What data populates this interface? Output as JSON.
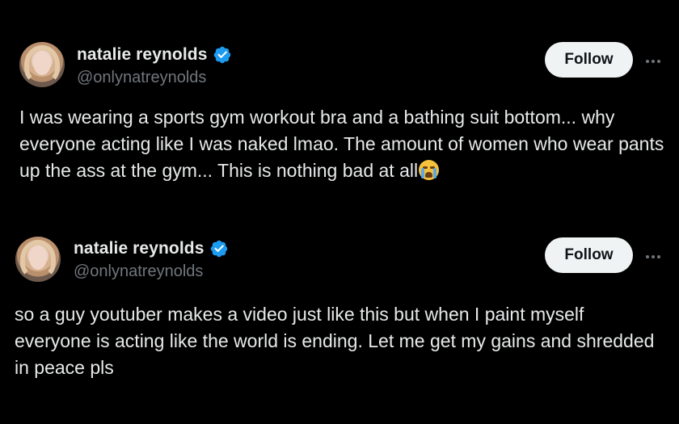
{
  "tweets": [
    {
      "name": "natalie reynolds",
      "handle": "@onlynatreynolds",
      "follow_label": "Follow",
      "verified_icon": "verified-badge-icon",
      "text": "I was wearing a sports gym workout bra and a bathing suit bottom... why everyone acting like I was naked lmao. The amount of women who wear pants up the ass at the gym... This is nothing bad at all",
      "emoji": "loudly-crying-face-emoji"
    },
    {
      "name": "natalie reynolds",
      "handle": "@onlynatreynolds",
      "follow_label": "Follow",
      "verified_icon": "verified-badge-icon",
      "text": "so a guy youtuber makes a video just like this but when I paint myself everyone is acting like the world is ending. Let me get my gains and shredded in peace pls"
    }
  ],
  "colors": {
    "background": "#000000",
    "text": "#e7e9ea",
    "secondary": "#71767b",
    "verified": "#1d9bf0",
    "follow_bg": "#eff3f4"
  }
}
